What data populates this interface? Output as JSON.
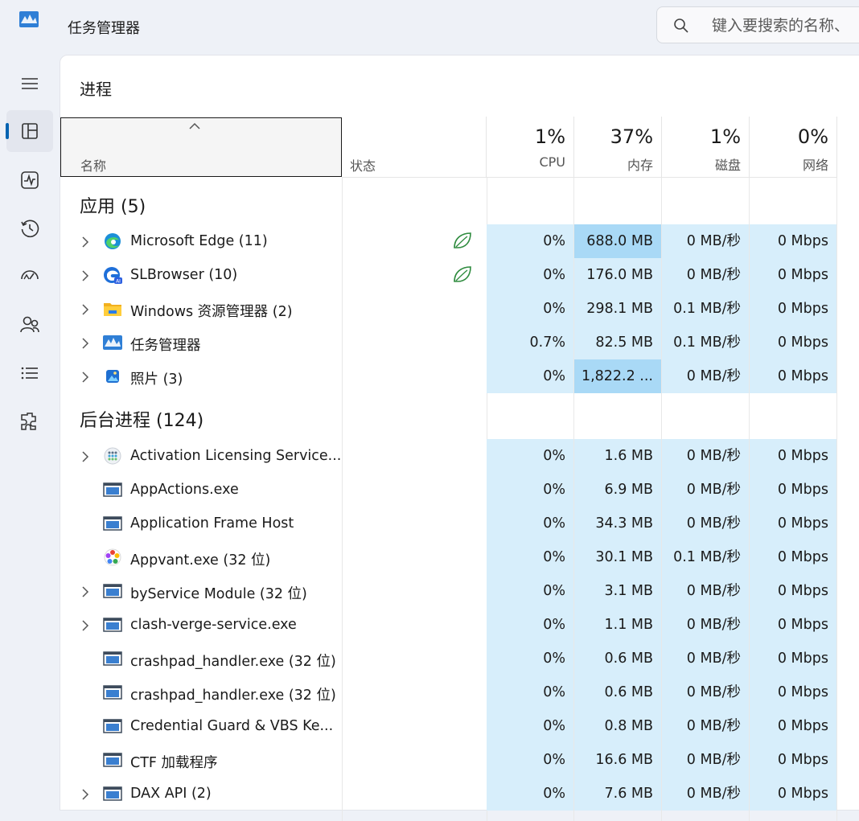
{
  "window": {
    "title": "任务管理器"
  },
  "search": {
    "placeholder": "键入要搜索的名称、"
  },
  "page": {
    "title": "进程"
  },
  "columns": {
    "name": "名称",
    "status": "状态",
    "cpu": {
      "pct": "1%",
      "label": "CPU"
    },
    "memory": {
      "pct": "37%",
      "label": "内存"
    },
    "disk": {
      "pct": "1%",
      "label": "磁盘"
    },
    "network": {
      "pct": "0%",
      "label": "网络"
    }
  },
  "groups": {
    "apps": {
      "title": "应用 (5)"
    },
    "background": {
      "title": "后台进程 (124)"
    }
  },
  "apps": [
    {
      "name": "Microsoft Edge (11)",
      "icon": "edge-icon",
      "expandable": true,
      "efficiency": true,
      "cpu": "0%",
      "mem": "688.0 MB",
      "disk": "0 MB/秒",
      "net": "0 Mbps",
      "mem_hi": true
    },
    {
      "name": "SLBrowser (10)",
      "icon": "slbrowser-icon",
      "expandable": true,
      "efficiency": true,
      "cpu": "0%",
      "mem": "176.0 MB",
      "disk": "0 MB/秒",
      "net": "0 Mbps"
    },
    {
      "name": "Windows 资源管理器 (2)",
      "icon": "folder-icon",
      "expandable": true,
      "cpu": "0%",
      "mem": "298.1 MB",
      "disk": "0.1 MB/秒",
      "net": "0 Mbps"
    },
    {
      "name": "任务管理器",
      "icon": "task-manager-icon",
      "expandable": true,
      "cpu": "0.7%",
      "mem": "82.5 MB",
      "disk": "0.1 MB/秒",
      "net": "0 Mbps"
    },
    {
      "name": "照片 (3)",
      "icon": "photos-icon",
      "expandable": true,
      "cpu": "0%",
      "mem": "1,822.2 ...",
      "disk": "0 MB/秒",
      "net": "0 Mbps",
      "mem_hi": true
    }
  ],
  "background": [
    {
      "name": "Activation Licensing Service...",
      "icon": "licensing-icon",
      "expandable": true,
      "cpu": "0%",
      "mem": "1.6 MB",
      "disk": "0 MB/秒",
      "net": "0 Mbps"
    },
    {
      "name": "AppActions.exe",
      "icon": "window-app-icon",
      "expandable": false,
      "cpu": "0%",
      "mem": "6.9 MB",
      "disk": "0 MB/秒",
      "net": "0 Mbps"
    },
    {
      "name": "Application Frame Host",
      "icon": "window-app-icon",
      "expandable": false,
      "cpu": "0%",
      "mem": "34.3 MB",
      "disk": "0 MB/秒",
      "net": "0 Mbps"
    },
    {
      "name": "Appvant.exe (32 位)",
      "icon": "appvant-icon",
      "expandable": false,
      "cpu": "0%",
      "mem": "30.1 MB",
      "disk": "0.1 MB/秒",
      "net": "0 Mbps"
    },
    {
      "name": "byService Module (32 位)",
      "icon": "window-app-icon",
      "expandable": true,
      "cpu": "0%",
      "mem": "3.1 MB",
      "disk": "0 MB/秒",
      "net": "0 Mbps"
    },
    {
      "name": "clash-verge-service.exe",
      "icon": "window-app-icon",
      "expandable": true,
      "cpu": "0%",
      "mem": "1.1 MB",
      "disk": "0 MB/秒",
      "net": "0 Mbps"
    },
    {
      "name": "crashpad_handler.exe (32 位)",
      "icon": "window-app-icon",
      "expandable": false,
      "cpu": "0%",
      "mem": "0.6 MB",
      "disk": "0 MB/秒",
      "net": "0 Mbps"
    },
    {
      "name": "crashpad_handler.exe (32 位)",
      "icon": "window-app-icon",
      "expandable": false,
      "cpu": "0%",
      "mem": "0.6 MB",
      "disk": "0 MB/秒",
      "net": "0 Mbps"
    },
    {
      "name": "Credential Guard & VBS Ke...",
      "icon": "window-app-icon",
      "expandable": false,
      "cpu": "0%",
      "mem": "0.8 MB",
      "disk": "0 MB/秒",
      "net": "0 Mbps"
    },
    {
      "name": "CTF 加载程序",
      "icon": "window-app-icon",
      "expandable": false,
      "cpu": "0%",
      "mem": "16.6 MB",
      "disk": "0 MB/秒",
      "net": "0 Mbps"
    },
    {
      "name": "DAX API (2)",
      "icon": "window-app-icon",
      "expandable": true,
      "cpu": "0%",
      "mem": "7.6 MB",
      "disk": "0 MB/秒",
      "net": "0 Mbps"
    }
  ],
  "nav": [
    {
      "icon": "hamburger-menu-icon"
    },
    {
      "icon": "processes-icon",
      "active": true
    },
    {
      "icon": "performance-icon"
    },
    {
      "icon": "app-history-icon"
    },
    {
      "icon": "startup-apps-icon"
    },
    {
      "icon": "users-icon"
    },
    {
      "icon": "details-icon"
    },
    {
      "icon": "services-icon"
    }
  ],
  "colors": {
    "accent": "#0063b1",
    "cell": "#d7eefb",
    "cell_highlight": "#a9d9f6",
    "efficiency_leaf": "#2e8b3e"
  }
}
